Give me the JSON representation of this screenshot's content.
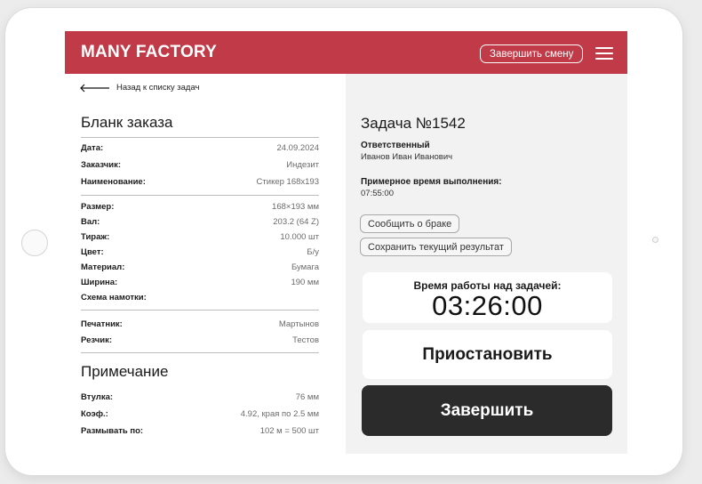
{
  "header": {
    "logo": "MANY FACTORY",
    "end_shift_label": "Завершить смену"
  },
  "back_link": "Назад к списку задач",
  "order_form": {
    "title": "Бланк заказа",
    "group1": [
      {
        "key": "Дата:",
        "value": "24.09.2024"
      },
      {
        "key": "Заказчик:",
        "value": "Индезит"
      },
      {
        "key": "Наименование:",
        "value": "Стикер 168x193"
      }
    ],
    "group2": [
      {
        "key": "Размер:",
        "value": "168×193 мм"
      },
      {
        "key": "Вал:",
        "value": "203.2 (64 Z)"
      },
      {
        "key": "Тираж:",
        "value": "10.000 шт"
      },
      {
        "key": "Цвет:",
        "value": "Б/у"
      },
      {
        "key": "Материал:",
        "value": "Бумага"
      },
      {
        "key": "Ширина:",
        "value": "190 мм"
      },
      {
        "key": "Схема намотки:",
        "value": ""
      }
    ],
    "group3": [
      {
        "key": "Печатник:",
        "value": "Мартынов"
      },
      {
        "key": "Резчик:",
        "value": "Тестов"
      }
    ]
  },
  "notes": {
    "title": "Примечание",
    "rows": [
      {
        "key": "Втулка:",
        "value": "76 мм"
      },
      {
        "key": "Коэф.:",
        "value": "4.92, края по 2.5 мм"
      },
      {
        "key": "Размывать по:",
        "value": "102 м = 500 шт"
      }
    ]
  },
  "task": {
    "title": "Задача №1542",
    "responsible_label": "Ответственный",
    "responsible_value": "Иванов Иван Иванович",
    "eta_label": "Примерное время выполнения:",
    "eta_value": "07:55:00",
    "report_defect_label": "Сообщить о браке",
    "save_result_label": "Сохранить текущий результат",
    "timer_label": "Время работы над задачей:",
    "timer_value": "03:26:00",
    "pause_label": "Приостановить",
    "finish_label": "Завершить"
  },
  "colors": {
    "header": "#c13a47",
    "finish_button": "#2b2b2b",
    "right_panel": "#f2f2f2"
  },
  "icons": [
    "menu-icon",
    "arrow-left-icon"
  ]
}
